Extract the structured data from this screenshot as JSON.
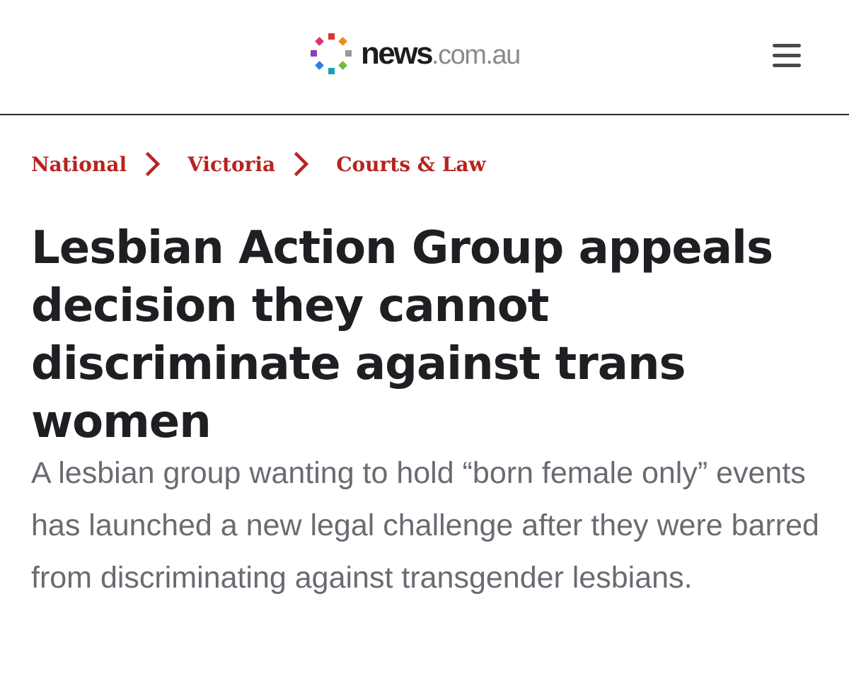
{
  "header": {
    "logo": {
      "name_bold": "news",
      "name_domain": ".com.au",
      "dot_colors": [
        "#e0342f",
        "#f08a1e",
        "#999999",
        "#6cbf3a",
        "#1a9fb4",
        "#2a7de1",
        "#8a3fb8",
        "#d8347b"
      ]
    },
    "menu_icon": "hamburger-icon"
  },
  "breadcrumb": {
    "items": [
      "National",
      "Victoria",
      "Courts & Law"
    ],
    "separator_icon": "chevron-right-icon",
    "color": "#b8231f"
  },
  "article": {
    "headline": "Lesbian Action Group appeals decision they cannot discriminate against trans women",
    "standfirst": "A lesbian group wanting to hold “born female only” events has launched a new legal challenge after they were barred from discriminating against transgender lesbians."
  }
}
